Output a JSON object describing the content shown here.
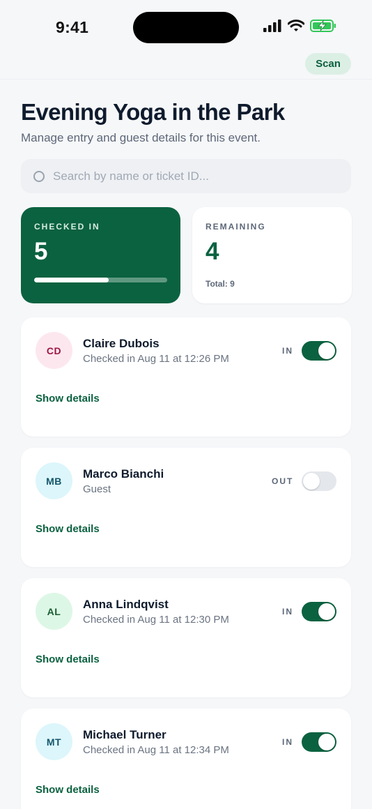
{
  "status_bar": {
    "time": "9:41"
  },
  "nav": {
    "scan_label": "Scan"
  },
  "header": {
    "title": "Evening Yoga in the Park",
    "subtitle": "Manage entry and guest details for this event."
  },
  "search": {
    "placeholder": "Search by name or ticket ID...",
    "value": ""
  },
  "stats": {
    "checked_in_label": "CHECKED IN",
    "checked_in_value": "5",
    "checked_in_progress": 0.56,
    "remaining_label": "REMAINING",
    "remaining_value": "4",
    "total_text": "Total: 9"
  },
  "colors": {
    "accent": "#0b6240",
    "scan_bg": "#dcefe5",
    "page_bg": "#f6f7f9"
  },
  "guests": [
    {
      "initials": "CD",
      "name": "Claire Dubois",
      "subtitle": "Checked in Aug 11 at 12:26 PM",
      "status": "IN",
      "checked_in": true,
      "avatar_bg": "#fde7ef",
      "avatar_fg": "#9d1845",
      "details_label": "Show details"
    },
    {
      "initials": "MB",
      "name": "Marco Bianchi",
      "subtitle": "Guest",
      "status": "OUT",
      "checked_in": false,
      "avatar_bg": "#dcf6fb",
      "avatar_fg": "#15566b",
      "details_label": "Show details"
    },
    {
      "initials": "AL",
      "name": "Anna Lindqvist",
      "subtitle": "Checked in Aug 11 at 12:30 PM",
      "status": "IN",
      "checked_in": true,
      "avatar_bg": "#ddf7e6",
      "avatar_fg": "#1b5e34",
      "details_label": "Show details"
    },
    {
      "initials": "MT",
      "name": "Michael Turner",
      "subtitle": "Checked in Aug 11 at 12:34 PM",
      "status": "IN",
      "checked_in": true,
      "avatar_bg": "#dcf6fb",
      "avatar_fg": "#15566b",
      "details_label": "Show details"
    }
  ]
}
